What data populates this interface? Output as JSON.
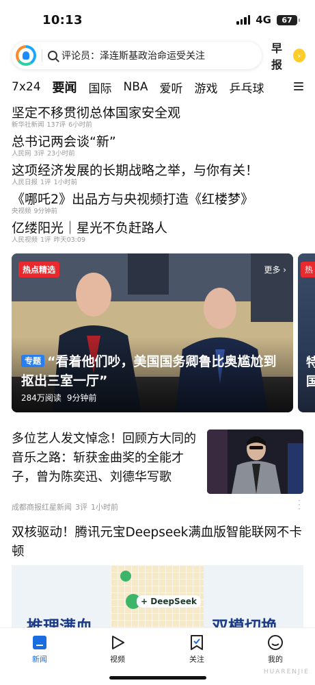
{
  "status_bar": {
    "time": "10:13",
    "network": "4G",
    "battery": "67"
  },
  "search": {
    "query": "评论员：泽连斯基政治命运受关注",
    "zaobao_label": "早报"
  },
  "tabs": [
    {
      "label": "7x24"
    },
    {
      "label": "要闻",
      "active": true
    },
    {
      "label": "国际"
    },
    {
      "label": "NBA"
    },
    {
      "label": "爱听"
    },
    {
      "label": "游戏"
    },
    {
      "label": "乒乓球"
    }
  ],
  "headlines": [
    {
      "title": "坚定不移贯彻总体国家安全观",
      "source": "新华社新闻",
      "comments": "137评",
      "time": "6小时前"
    },
    {
      "title": "总书记两会谈“新”",
      "source": "人民网",
      "comments": "3评",
      "time": "23小时前"
    },
    {
      "title": "这项经济发展的长期战略之举，与你有关！",
      "source": "人民日报",
      "comments": "1评",
      "time": "1小时前"
    },
    {
      "title": "《哪吒2》出品方与央视频打造《红楼梦》",
      "source": "央视频",
      "comments": "",
      "time": "9分钟前"
    },
    {
      "title": "亿缕阳光｜星光不负赶路人",
      "source": "人民视频",
      "comments": "1评",
      "time": "昨天03:09"
    }
  ],
  "carousel": {
    "badge": "热点精选",
    "more": "更多 ›",
    "tag": "专题",
    "title": "“看着他们吵，美国国务卿鲁比奥尴尬到抠出三室一厅”",
    "reads": "284万阅读",
    "time": "9分钟前",
    "next_badge": "热",
    "next_text": "特国"
  },
  "article": {
    "title": "多位艺人发文悼念！回顾方大同的音乐之路：斩获金曲奖的全能才子，曾为陈奕迅、刘德华写歌",
    "source": "成都商报红星新闻",
    "comments": "3评",
    "time": "1小时前"
  },
  "article2": {
    "title": "双核驱动！腾讯元宝Deepseek满血版智能联网不卡顿",
    "promo_pill": "+ DeepSeek",
    "promo_left": "推理满血",
    "promo_right": "双模切换"
  },
  "bottom_nav": [
    {
      "label": "新闻",
      "icon": "news-icon",
      "active": true
    },
    {
      "label": "视频",
      "icon": "play-icon"
    },
    {
      "label": "关注",
      "icon": "bookmark-icon"
    },
    {
      "label": "我的",
      "icon": "profile-icon"
    }
  ],
  "watermark": "HUARENJIE",
  "colors": {
    "accent": "#1a6de0",
    "hot_badge": "#e8292e",
    "topic_tag": "#2a7ef0",
    "zaobao": "#ffcc2a"
  }
}
